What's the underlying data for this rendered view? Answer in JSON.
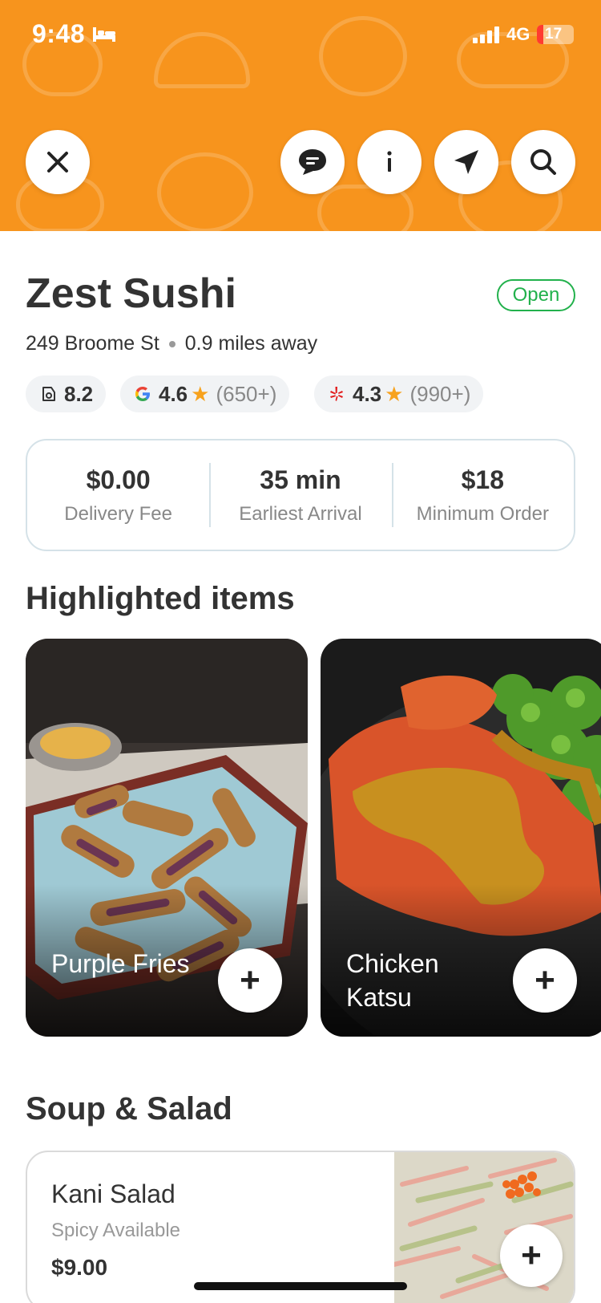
{
  "status_bar": {
    "time": "9:48",
    "network": "4G",
    "battery": "17",
    "battery_level": 0.17
  },
  "restaurant": {
    "name": "Zest Sushi",
    "status": "Open",
    "address": "249 Broome St",
    "distance": "0.9 miles away",
    "ratings": [
      {
        "source": "app-score-icon",
        "score": "8.2",
        "count": ""
      },
      {
        "source": "google-icon",
        "score": "4.6",
        "count": "(650+)"
      },
      {
        "source": "yelp-icon",
        "score": "4.3",
        "count": "(990+)"
      }
    ],
    "stats": [
      {
        "value": "$0.00",
        "label": "Delivery Fee"
      },
      {
        "value": "35 min",
        "label": "Earliest Arrival"
      },
      {
        "value": "$18",
        "label": "Minimum Order"
      }
    ]
  },
  "sections": {
    "highlighted_title": "Highlighted items",
    "soup_title": "Soup & Salad"
  },
  "highlighted_items": [
    {
      "name": "Purple Fries"
    },
    {
      "name": "Chicken Katsu"
    }
  ],
  "menu_items": [
    {
      "name": "Kani Salad",
      "note": "Spicy Available",
      "price": "$9.00"
    }
  ],
  "colors": {
    "brand": "#F7941D",
    "open": "#22B14C",
    "star": "#F7A21D"
  }
}
